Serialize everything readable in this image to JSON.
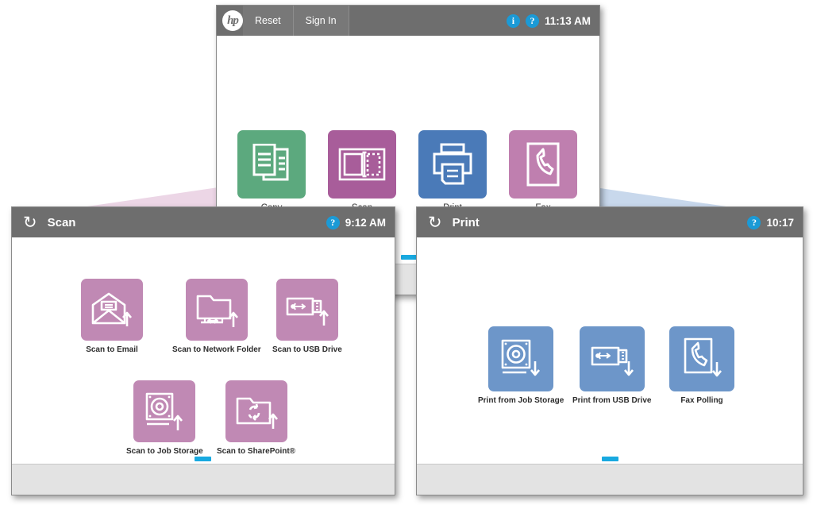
{
  "colors": {
    "header_bg": "#6e6e6e",
    "accent_blue": "#18a9e0",
    "copy_green": "#5ca97e",
    "scan_magenta": "#a85d9a",
    "print_blue": "#4a7ab8",
    "fax_pink": "#bf7faf",
    "scan_tile": "#c089b4",
    "print_tile": "#6d96c9",
    "funnel_pink": "#ecd6e6",
    "funnel_blue": "#c8d8ec",
    "footer_gray": "#e3e3e3"
  },
  "home_panel": {
    "logo": "hp",
    "logo_icon": "hp-logo-icon",
    "buttons": [
      {
        "label": "Reset",
        "name": "reset-button"
      },
      {
        "label": "Sign In",
        "name": "sign-in-button"
      }
    ],
    "info_icon": "info-icon",
    "info_glyph": "i",
    "help_icon": "help-icon",
    "help_glyph": "?",
    "time": "11:13 AM",
    "tiles": [
      {
        "label": "Copy",
        "icon": "copy-icon",
        "color": "#5ca97e",
        "name": "tile-copy"
      },
      {
        "label": "Scan",
        "icon": "scan-icon",
        "color": "#a85d9a",
        "name": "tile-scan"
      },
      {
        "label": "Print",
        "icon": "print-icon",
        "color": "#4a7ab8",
        "name": "tile-print"
      },
      {
        "label": "Fax",
        "icon": "fax-icon",
        "color": "#bf7faf",
        "name": "tile-fax"
      }
    ]
  },
  "scan_panel": {
    "back_icon": "back-arrow-icon",
    "back_glyph": "↺",
    "title": "Scan",
    "help_icon": "help-icon",
    "help_glyph": "?",
    "time": "9:12 AM",
    "tiles": [
      {
        "label": "Scan to Email",
        "icon": "scan-to-email-icon",
        "name": "tile-scan-to-email"
      },
      {
        "label": "Scan to Network Folder",
        "icon": "scan-to-network-folder-icon",
        "name": "tile-scan-to-network-folder"
      },
      {
        "label": "Scan to USB Drive",
        "icon": "scan-to-usb-drive-icon",
        "name": "tile-scan-to-usb-drive"
      },
      {
        "label": "Scan to Job Storage",
        "icon": "scan-to-job-storage-icon",
        "name": "tile-scan-to-job-storage"
      },
      {
        "label": "Scan to SharePoint®",
        "icon": "scan-to-sharepoint-icon",
        "name": "tile-scan-to-sharepoint"
      }
    ]
  },
  "print_panel": {
    "back_icon": "back-arrow-icon",
    "back_glyph": "↺",
    "title": "Print",
    "help_icon": "help-icon",
    "help_glyph": "?",
    "time": "10:17",
    "tiles": [
      {
        "label": "Print from Job Storage",
        "icon": "print-from-job-storage-icon",
        "name": "tile-print-from-job-storage"
      },
      {
        "label": "Print from USB Drive",
        "icon": "print-from-usb-drive-icon",
        "name": "tile-print-from-usb-drive"
      },
      {
        "label": "Fax Polling",
        "icon": "fax-polling-icon",
        "name": "tile-fax-polling"
      }
    ]
  }
}
